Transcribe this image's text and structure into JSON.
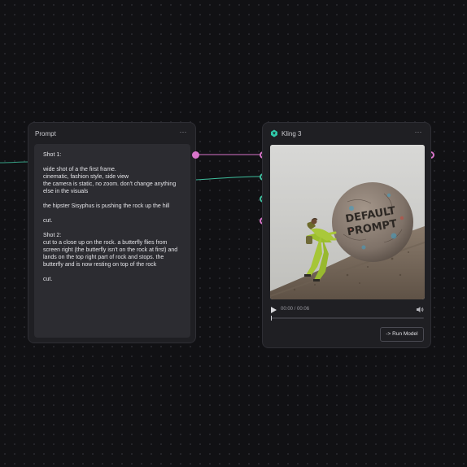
{
  "prompt_node": {
    "title": "Prompt",
    "more_icon": "⋯",
    "text": "Shot 1:\n\nwide shot of a the first frame.\ncinematic, fashion style, side view\nthe camera is static, no zoom. don't change anything else in the visuals\n\nthe hipster Sisyphus is pushing the rock up the hill\n\ncut.\n\nShot 2:\ncut to a close up on the rock. a butterfly flies from screen right (the butterfly isn't on the rock at first) and lands on the top right part of rock and stops. the butterfly and is now resting on top of the rock\n\ncut."
  },
  "kling_node": {
    "title": "Kling 3",
    "more_icon": "⋯",
    "logo_icon": "kling-logo-icon",
    "preview": {
      "rock_text_line1": "DEFAULT",
      "rock_text_line2": "PROMPT"
    },
    "player": {
      "time": "00:00 / 00:06",
      "progress": 0
    },
    "run_button": "-> Run Model"
  },
  "colors": {
    "canvas_background": "#111114",
    "node_background": "#1f1f23",
    "port_pink": "#d774c9",
    "port_teal": "#3fbf9e"
  }
}
